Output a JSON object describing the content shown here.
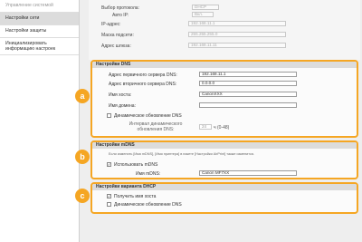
{
  "sidebar": {
    "items": [
      {
        "label": "Управление системой"
      },
      {
        "label": "Настройки сети"
      },
      {
        "label": "Настройки защиты"
      },
      {
        "label": "Инициализировать информацию настроек"
      }
    ]
  },
  "top": {
    "protocol_label": "Выбор протокола:",
    "protocol_value": "DHCP",
    "autoip_label": "Авто IP:",
    "autoip_value": "Вкл.",
    "ip_label": "IP-адрес:",
    "ip_value": "192.168.11.1",
    "mask_label": "Маска подсети:",
    "mask_value": "255.255.255.0",
    "gateway_label": "Адрес шлюза:",
    "gateway_value": "192.168.11.11"
  },
  "dns": {
    "title": "Настройки DNS",
    "primary_label": "Адрес первичного сервера DNS:",
    "primary_value": "192.168.11.1",
    "secondary_label": "Адрес вторичного сервера DNS:",
    "secondary_value": "0.0.0.0",
    "host_label": "Имя хоста:",
    "host_value": "CanonXXX",
    "domain_label": "Имя домена:",
    "domain_value": "",
    "dynamic_label": "Динамическое обновление DNS",
    "interval_label": "Интервал динамического обновления DNS:",
    "interval_value": "24",
    "interval_unit": "ч (0-48)"
  },
  "mdns": {
    "title": "Настройки mDNS",
    "note": "Если изменить [Имя mDNS], [Имя принтера] в пакете [Настройки AirPrint] также изменится.",
    "use_label": "Использовать mDNS",
    "name_label": "Имя mDNS:",
    "name_value": "Canon MF7XX"
  },
  "dhcp": {
    "title": "Настройки варианта DHCP",
    "hostname_label": "Получить имя хоста",
    "dynamic_label": "Динамическое обновление DNS"
  },
  "badges": {
    "a": "a",
    "b": "b",
    "c": "c"
  },
  "colors": {
    "accent": "#f5a623",
    "sidebar_active": "#dcdcdc"
  }
}
